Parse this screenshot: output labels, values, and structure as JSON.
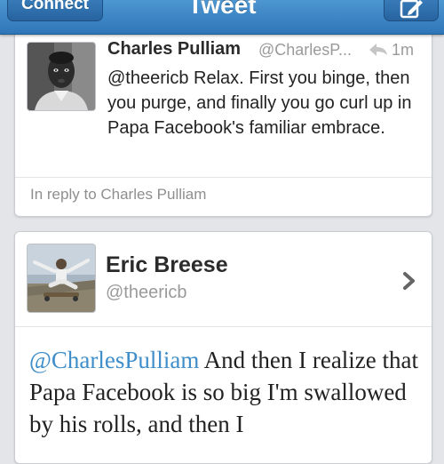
{
  "navbar": {
    "left_button_label": "Connect",
    "title": "Tweet",
    "right_button_icon": "compose-icon"
  },
  "reply_tweet": {
    "author_name": "Charles Pulliam",
    "author_handle": "@CharlesP...",
    "timestamp": "1m",
    "text": "@theericb Relax. First you binge, then you purge, and finally you go curl up in Papa Facebook's familiar embrace.",
    "context": "In reply to Charles Pulliam"
  },
  "main_tweet": {
    "author_name": "Eric Breese",
    "author_handle": "@theericb",
    "mention": "@CharlesPulliam",
    "text": " And then I realize that Papa Facebook is so big I'm swallowed by his rolls, and then I"
  },
  "colors": {
    "navbar": "#3a84c4",
    "mention": "#3f8ec9",
    "background": "#e3e5e8"
  }
}
